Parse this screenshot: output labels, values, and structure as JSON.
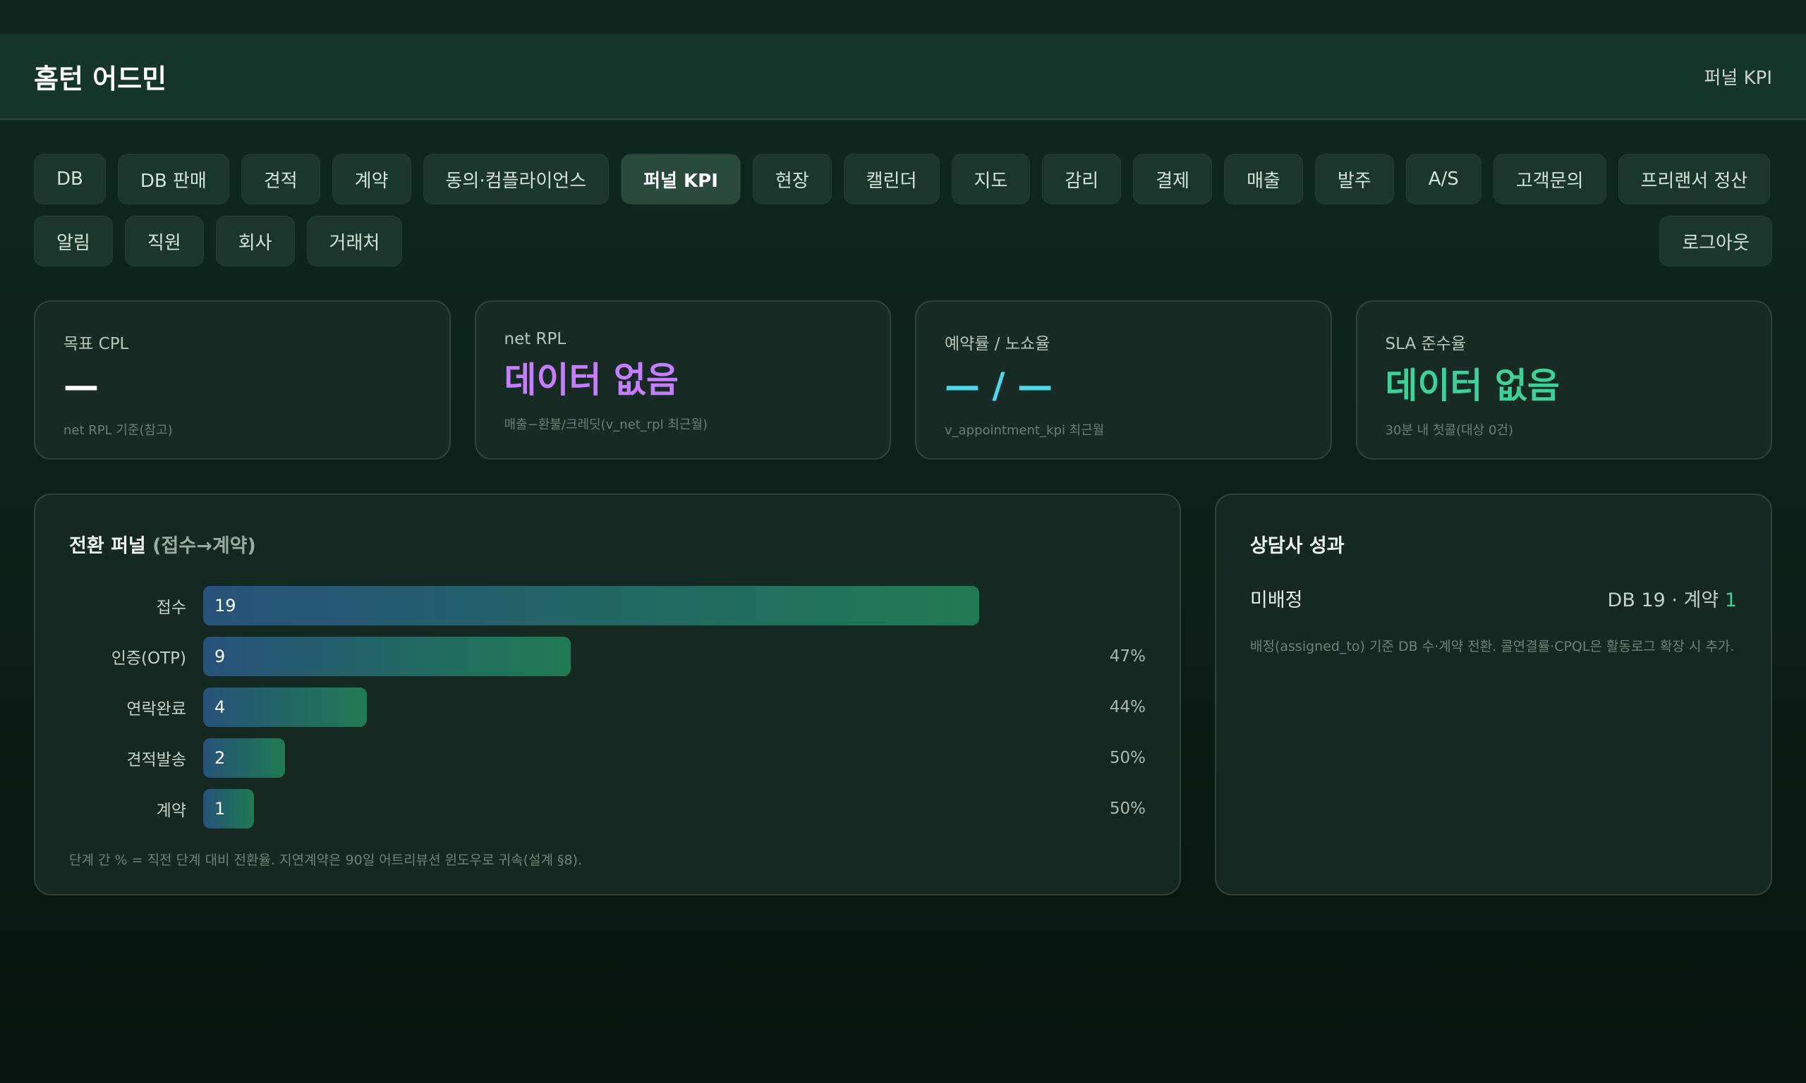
{
  "header": {
    "brand": "홈턴 어드민",
    "right_label": "퍼널 KPI"
  },
  "nav": {
    "row1": [
      {
        "label": "DB",
        "active": false
      },
      {
        "label": "DB 판매",
        "active": false
      },
      {
        "label": "견적",
        "active": false
      },
      {
        "label": "계약",
        "active": false
      },
      {
        "label": "동의·컴플라이언스",
        "active": false
      },
      {
        "label": "퍼널 KPI",
        "active": true
      },
      {
        "label": "현장",
        "active": false
      },
      {
        "label": "캘린더",
        "active": false
      },
      {
        "label": "지도",
        "active": false
      },
      {
        "label": "감리",
        "active": false
      },
      {
        "label": "결제",
        "active": false
      },
      {
        "label": "매출",
        "active": false
      },
      {
        "label": "발주",
        "active": false
      },
      {
        "label": "A/S",
        "active": false
      },
      {
        "label": "고객문의",
        "active": false
      },
      {
        "label": "프리랜서 정산",
        "active": false
      }
    ],
    "row2": [
      {
        "label": "알림"
      },
      {
        "label": "직원"
      },
      {
        "label": "회사"
      },
      {
        "label": "거래처"
      }
    ],
    "logout": "로그아웃"
  },
  "kpis": [
    {
      "label": "목표 CPL",
      "value": "—",
      "sub": "net RPL 기준(참고)",
      "color": "#ffffff"
    },
    {
      "label": "net RPL",
      "value": "데이터 없음",
      "sub": "매출−환불/크레딧(v_net_rpl 최근월)",
      "color": "#c77dff"
    },
    {
      "label": "예약률 / 노쇼율",
      "value": "— / —",
      "sub": "v_appointment_kpi 최근월",
      "color": "#4dd6ec"
    },
    {
      "label": "SLA 준수율",
      "value": "데이터 없음",
      "sub": "30분 내 첫콜(대상 0건)",
      "color": "#3ed29a"
    }
  ],
  "funnel": {
    "title": "전환 퍼널",
    "title_sub": "(접수→계약)",
    "max": 19,
    "stages": [
      {
        "label": "접수",
        "value": 19,
        "pct": ""
      },
      {
        "label": "인증(OTP)",
        "value": 9,
        "pct": "47%"
      },
      {
        "label": "연락완료",
        "value": 4,
        "pct": "44%"
      },
      {
        "label": "견적발송",
        "value": 2,
        "pct": "50%"
      },
      {
        "label": "계약",
        "value": 1,
        "pct": "50%"
      }
    ],
    "note": "단계 간 % = 직전 단계 대비 전환율. 지연계약은 90일 어트리뷰션 윈도우로 귀속(설계 §8)."
  },
  "advisor": {
    "title": "상담사 성과",
    "rows": [
      {
        "name": "미배정",
        "stats_prefix": "DB 19 · 계약 ",
        "contracts": "1"
      }
    ],
    "note": "배정(assigned_to) 기준 DB 수·계약 전환. 콜연결률·CPQL은 활동로그 확장 시 추가."
  }
}
